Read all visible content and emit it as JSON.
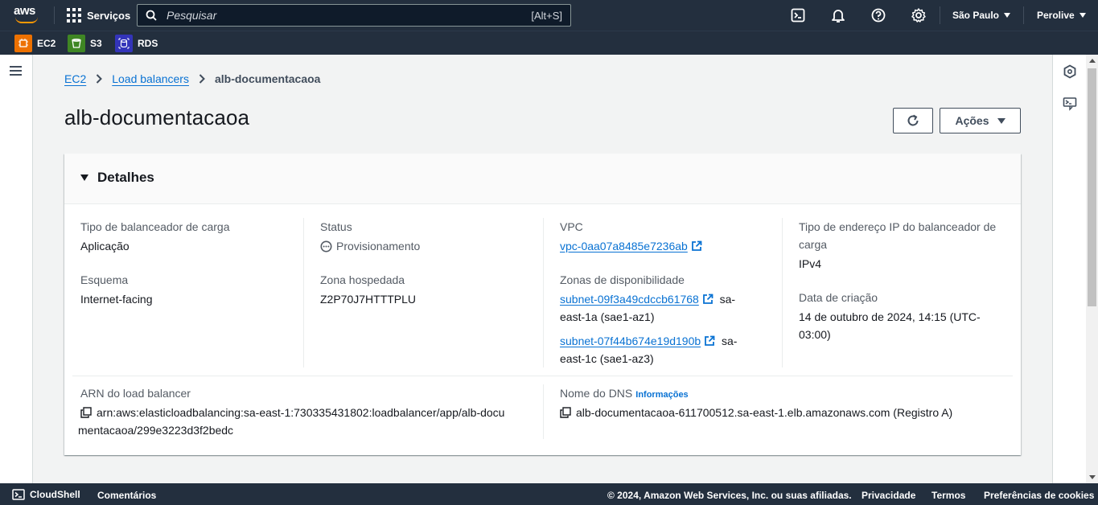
{
  "topnav": {
    "logo_text": "aws",
    "services_label": "Serviços",
    "search_placeholder": "Pesquisar",
    "search_shortcut": "[Alt+S]",
    "region_label": "São Paulo",
    "user_label": "Perolive",
    "icons": [
      "cloudshell-icon",
      "bell-icon",
      "help-icon",
      "gear-icon"
    ]
  },
  "favorites": [
    {
      "label": "EC2",
      "color": "#ed7100"
    },
    {
      "label": "S3",
      "color": "#3f8624"
    },
    {
      "label": "RDS",
      "color": "#3334b9"
    }
  ],
  "breadcrumb": {
    "items": [
      "EC2",
      "Load balancers"
    ],
    "current": "alb-documentacaoa"
  },
  "page": {
    "title": "alb-documentacaoa",
    "actions_label": "Ações"
  },
  "details": {
    "section_title": "Detalhes",
    "lb_type_label": "Tipo de balanceador de carga",
    "lb_type_value": "Aplicação",
    "scheme_label": "Esquema",
    "scheme_value": "Internet-facing",
    "status_label": "Status",
    "status_value": "Provisionamento",
    "hosted_zone_label": "Zona hospedada",
    "hosted_zone_value": "Z2P70J7HTTTPLU",
    "vpc_label": "VPC",
    "vpc_value": "vpc-0aa07a8485e7236ab",
    "az_label": "Zonas de disponibilidade",
    "az1_subnet": "subnet-09f3a49cdccb61768",
    "az1_suffix_a": "sa-",
    "az1_suffix_b": "east-1a (sae1-az1)",
    "az2_subnet": "subnet-07f44b674e19d190b",
    "az2_suffix_a": "sa-",
    "az2_suffix_b": "east-1c (sae1-az3)",
    "ip_type_label_1": "Tipo de endereço IP do balanceador de",
    "ip_type_label_2": "carga",
    "ip_type_value": "IPv4",
    "created_label": "Data de criação",
    "created_value_1": "14 de outubro de 2024, 14:15 (UTC-",
    "created_value_2": "03:00)",
    "arn_label": "ARN do load balancer",
    "arn_value_1": "arn:aws:elasticloadbalancing:sa-east-1:730335431802:loadbalancer/app/alb-docu",
    "arn_value_2": "mentacaoa/299e3223d3f2bedc",
    "dns_label": "Nome do DNS",
    "dns_info": "Informações",
    "dns_value": "alb-documentacaoa-611700512.sa-east-1.elb.amazonaws.com (Registro A)"
  },
  "footer": {
    "cloudshell": "CloudShell",
    "feedback": "Comentários",
    "copyright": "© 2024, Amazon Web Services, Inc. ou suas afiliadas.",
    "privacy": "Privacidade",
    "terms": "Termos",
    "cookies": "Preferências de cookies"
  }
}
